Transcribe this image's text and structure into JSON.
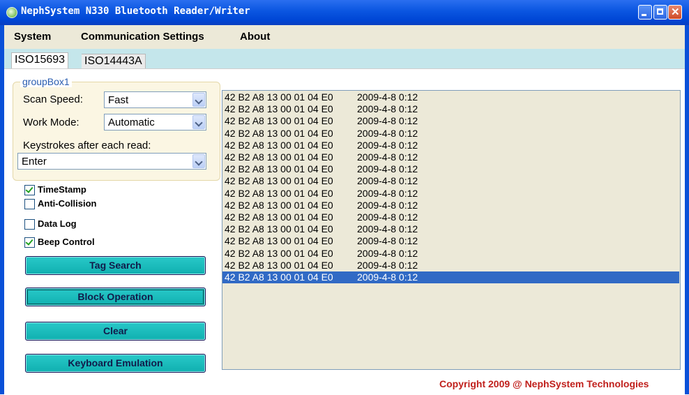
{
  "window": {
    "title": "NephSystem N330 Bluetooth Reader/Writer"
  },
  "menu": {
    "items": [
      "System",
      "Communication Settings",
      "About"
    ]
  },
  "tabs": [
    "ISO15693",
    "ISO14443A"
  ],
  "groupbox": {
    "title": "groupBox1",
    "scan_speed_label": "Scan Speed:",
    "scan_speed_value": "Fast",
    "work_mode_label": "Work Mode:",
    "work_mode_value": "Automatic",
    "keystrokes_label": "Keystrokes after each read:",
    "keystrokes_value": "Enter"
  },
  "checkboxes": [
    {
      "label": "TimeStamp",
      "checked": true
    },
    {
      "label": "Anti-Collision",
      "checked": false
    },
    {
      "label": "Data Log",
      "checked": false
    },
    {
      "label": "Beep Control",
      "checked": true
    }
  ],
  "buttons": {
    "tag_search": "Tag Search",
    "block_operation": "Block Operation",
    "clear": "Clear",
    "keyboard_emulation": "Keyboard Emulation"
  },
  "records": [
    {
      "tag": "42 B2 A8 13 00 01 04 E0",
      "time": "2009-4-8 0:12"
    },
    {
      "tag": "42 B2 A8 13 00 01 04 E0",
      "time": "2009-4-8 0:12"
    },
    {
      "tag": "42 B2 A8 13 00 01 04 E0",
      "time": "2009-4-8 0:12"
    },
    {
      "tag": "42 B2 A8 13 00 01 04 E0",
      "time": "2009-4-8 0:12"
    },
    {
      "tag": "42 B2 A8 13 00 01 04 E0",
      "time": "2009-4-8 0:12"
    },
    {
      "tag": "42 B2 A8 13 00 01 04 E0",
      "time": "2009-4-8 0:12"
    },
    {
      "tag": "42 B2 A8 13 00 01 04 E0",
      "time": "2009-4-8 0:12"
    },
    {
      "tag": "42 B2 A8 13 00 01 04 E0",
      "time": "2009-4-8 0:12"
    },
    {
      "tag": "42 B2 A8 13 00 01 04 E0",
      "time": "2009-4-8 0:12"
    },
    {
      "tag": "42 B2 A8 13 00 01 04 E0",
      "time": "2009-4-8 0:12"
    },
    {
      "tag": "42 B2 A8 13 00 01 04 E0",
      "time": "2009-4-8 0:12"
    },
    {
      "tag": "42 B2 A8 13 00 01 04 E0",
      "time": "2009-4-8 0:12"
    },
    {
      "tag": "42 B2 A8 13 00 01 04 E0",
      "time": "2009-4-8 0:12"
    },
    {
      "tag": "42 B2 A8 13 00 01 04 E0",
      "time": "2009-4-8 0:12"
    },
    {
      "tag": "42 B2 A8 13 00 01 04 E0",
      "time": "2009-4-8 0:12"
    },
    {
      "tag": "42 B2 A8 13 00 01 04 E0",
      "time": "2009-4-8 0:12"
    }
  ],
  "copyright": "Copyright 2009 @ NephSystem Technologies",
  "colors": {
    "titlebar": "#0046d5",
    "tabstrip": "#c4e6eb",
    "button": "#16baba",
    "selection": "#316ac5",
    "copyright": "#c0201c"
  }
}
